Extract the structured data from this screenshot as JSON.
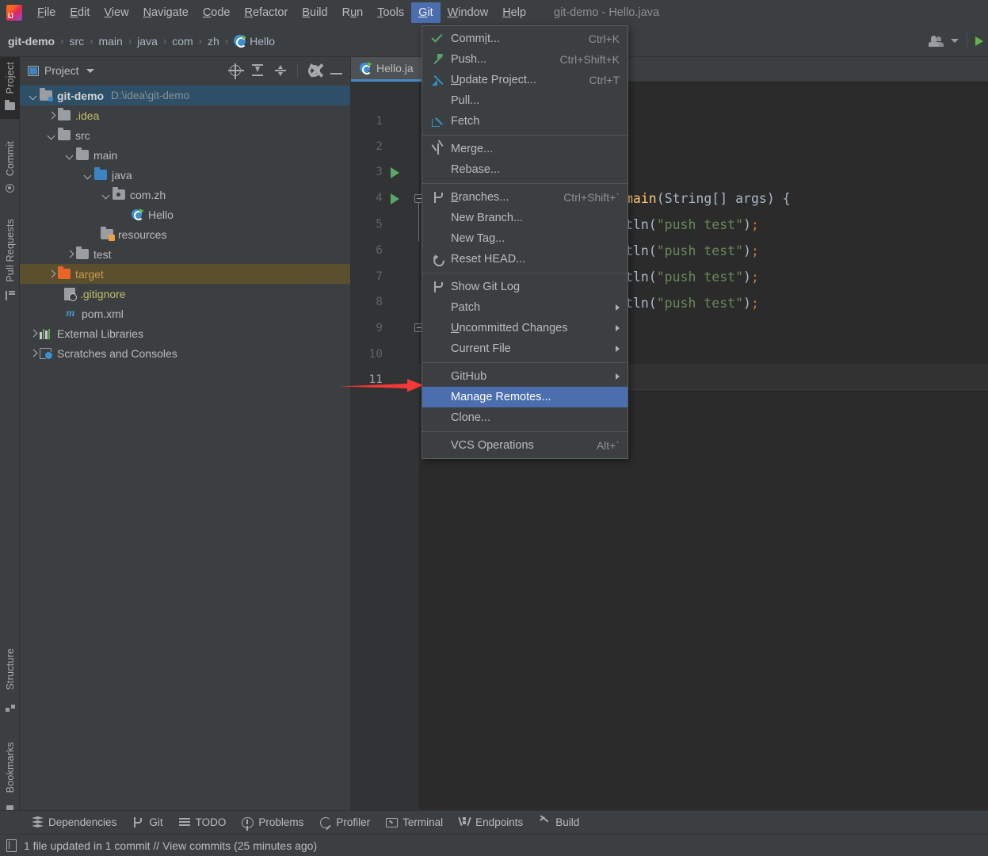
{
  "window": {
    "title": "git-demo - Hello.java"
  },
  "menubar": {
    "items": [
      {
        "label": "File",
        "mnemonic": "F"
      },
      {
        "label": "Edit",
        "mnemonic": "E"
      },
      {
        "label": "View",
        "mnemonic": "V"
      },
      {
        "label": "Navigate",
        "mnemonic": "N"
      },
      {
        "label": "Code",
        "mnemonic": "C"
      },
      {
        "label": "Refactor",
        "mnemonic": "R"
      },
      {
        "label": "Build",
        "mnemonic": "B"
      },
      {
        "label": "Run",
        "mnemonic": "n"
      },
      {
        "label": "Tools",
        "mnemonic": "T"
      },
      {
        "label": "Git",
        "mnemonic": "G",
        "active": true
      },
      {
        "label": "Window",
        "mnemonic": "W"
      },
      {
        "label": "Help",
        "mnemonic": "H"
      }
    ]
  },
  "breadcrumb": {
    "items": [
      "git-demo",
      "src",
      "main",
      "java",
      "com",
      "zh",
      "Hello"
    ],
    "separator": "›"
  },
  "project_panel": {
    "title": "Project",
    "toolbar": [
      "locate-icon",
      "expand-all-icon",
      "collapse-all-icon",
      "gear-icon",
      "hide-icon"
    ],
    "tree": [
      {
        "label": "git-demo",
        "path": "D:\\idea\\git-demo",
        "icon": "module-folder",
        "indent": 0,
        "arrow": "down",
        "selected": true,
        "bold": true
      },
      {
        "label": ".idea",
        "icon": "folder-grey",
        "indent": 1,
        "arrow": "right",
        "color": "yellowish"
      },
      {
        "label": "src",
        "icon": "folder-grey",
        "indent": 1,
        "arrow": "down"
      },
      {
        "label": "main",
        "icon": "folder-grey",
        "indent": 2,
        "arrow": "down"
      },
      {
        "label": "java",
        "icon": "folder-blue",
        "indent": 3,
        "arrow": "down"
      },
      {
        "label": "com.zh",
        "icon": "package",
        "indent": 4,
        "arrow": "down"
      },
      {
        "label": "Hello",
        "icon": "java-class",
        "indent": 5,
        "arrow": "none"
      },
      {
        "label": "resources",
        "icon": "folder-resources",
        "indent": 3,
        "arrow": "none"
      },
      {
        "label": "test",
        "icon": "folder-grey",
        "indent": 2,
        "arrow": "right"
      },
      {
        "label": "target",
        "icon": "folder-orange",
        "indent": 1,
        "arrow": "right",
        "color": "orange-txt",
        "highlight": "modified"
      },
      {
        "label": ".gitignore",
        "icon": "gitignore",
        "indent": 1,
        "arrow": "none",
        "color": "yellowish"
      },
      {
        "label": "pom.xml",
        "icon": "maven",
        "indent": 1,
        "arrow": "none"
      },
      {
        "label": "External Libraries",
        "icon": "libraries",
        "indent": 0,
        "arrow": "right"
      },
      {
        "label": "Scratches and Consoles",
        "icon": "scratches",
        "indent": 0,
        "arrow": "right"
      }
    ]
  },
  "tool_strip": {
    "left_top": [
      {
        "label": "Project",
        "icon": "folder-icon",
        "selected": true
      },
      {
        "label": "Commit",
        "icon": "commit-icon",
        "selected": false
      },
      {
        "label": "Pull Requests",
        "icon": "pull-requests-icon",
        "selected": false
      }
    ],
    "left_bottom": [
      {
        "label": "Structure",
        "icon": "structure-icon"
      },
      {
        "label": "Bookmarks",
        "icon": "bookmark-icon"
      }
    ]
  },
  "editor": {
    "tab": {
      "label": "Hello.ja",
      "icon": "java-class-icon"
    },
    "line_numbers": [
      "1",
      "2",
      "3",
      "4",
      "5",
      "6",
      "7",
      "8",
      "9",
      "10",
      "11"
    ],
    "current_line": 11,
    "run_markers": [
      3,
      4
    ],
    "fold_markers": [
      4,
      9
    ],
    "code_fragments": [
      {
        "line": 4,
        "text": "main(String[] args) {"
      },
      {
        "line": 5,
        "text": "tln(\"push test\");"
      },
      {
        "line": 6,
        "text": "tln(\"push test\");"
      },
      {
        "line": 7,
        "text": "tln(\"push test\");"
      },
      {
        "line": 8,
        "text": "tln(\"push test\");"
      }
    ]
  },
  "git_menu": {
    "items": [
      {
        "label": "Commit...",
        "mnemonic": "i",
        "shortcut": "Ctrl+K",
        "icon": "commit-check-icon"
      },
      {
        "label": "Push...",
        "mnemonic": "",
        "shortcut": "Ctrl+Shift+K",
        "icon": "push-arrow-icon"
      },
      {
        "label": "Update Project...",
        "mnemonic": "U",
        "shortcut": "Ctrl+T",
        "icon": "update-arrow-icon"
      },
      {
        "label": "Pull...",
        "shortcut": "",
        "icon": "none"
      },
      {
        "label": "Fetch",
        "shortcut": "",
        "icon": "fetch-icon"
      },
      {
        "separator": true
      },
      {
        "label": "Merge...",
        "shortcut": "",
        "icon": "merge-icon"
      },
      {
        "label": "Rebase...",
        "shortcut": "",
        "icon": "none"
      },
      {
        "separator": true
      },
      {
        "label": "Branches...",
        "mnemonic": "B",
        "shortcut": "Ctrl+Shift+`",
        "icon": "branch-icon"
      },
      {
        "label": "New Branch...",
        "shortcut": "",
        "icon": "none"
      },
      {
        "label": "New Tag...",
        "shortcut": "",
        "icon": "none"
      },
      {
        "label": "Reset HEAD...",
        "shortcut": "",
        "icon": "reset-icon"
      },
      {
        "separator": true
      },
      {
        "label": "Show Git Log",
        "shortcut": "",
        "icon": "branch-icon"
      },
      {
        "label": "Patch",
        "shortcut": "",
        "icon": "none",
        "submenu": true
      },
      {
        "label": "Uncommitted Changes",
        "mnemonic": "U",
        "shortcut": "",
        "icon": "none",
        "submenu": true
      },
      {
        "label": "Current File",
        "shortcut": "",
        "icon": "none",
        "submenu": true
      },
      {
        "separator": true
      },
      {
        "label": "GitHub",
        "shortcut": "",
        "icon": "none",
        "submenu": true
      },
      {
        "label": "Manage Remotes...",
        "shortcut": "",
        "icon": "none",
        "highlighted": true
      },
      {
        "label": "Clone...",
        "shortcut": "",
        "icon": "none"
      },
      {
        "separator": true
      },
      {
        "label": "VCS Operations",
        "shortcut": "Alt+`",
        "icon": "none"
      }
    ]
  },
  "annotation": {
    "arrow_color": "#f63838",
    "points_to": "Manage Remotes..."
  },
  "bottom_tools": [
    {
      "label": "Dependencies",
      "icon": "dependencies-icon"
    },
    {
      "label": "Git",
      "icon": "git-branch-icon"
    },
    {
      "label": "TODO",
      "icon": "todo-icon"
    },
    {
      "label": "Problems",
      "icon": "problems-icon"
    },
    {
      "label": "Profiler",
      "icon": "profiler-icon"
    },
    {
      "label": "Terminal",
      "icon": "terminal-icon"
    },
    {
      "label": "Endpoints",
      "icon": "endpoints-icon"
    },
    {
      "label": "Build",
      "icon": "build-icon"
    }
  ],
  "statusbar": {
    "message": "1 file updated in 1 commit // View commits (25 minutes ago)",
    "icon": "event-log-icon"
  },
  "colors": {
    "panel_bg": "#3c3f41",
    "editor_bg": "#2b2b2b",
    "gutter_bg": "#313335",
    "selection_blue": "#4b6eaf",
    "tree_selection": "#2d4f67",
    "modified_row": "#5b4f2d",
    "accent_tab": "#4a88c7",
    "arrow_red": "#f63838"
  }
}
